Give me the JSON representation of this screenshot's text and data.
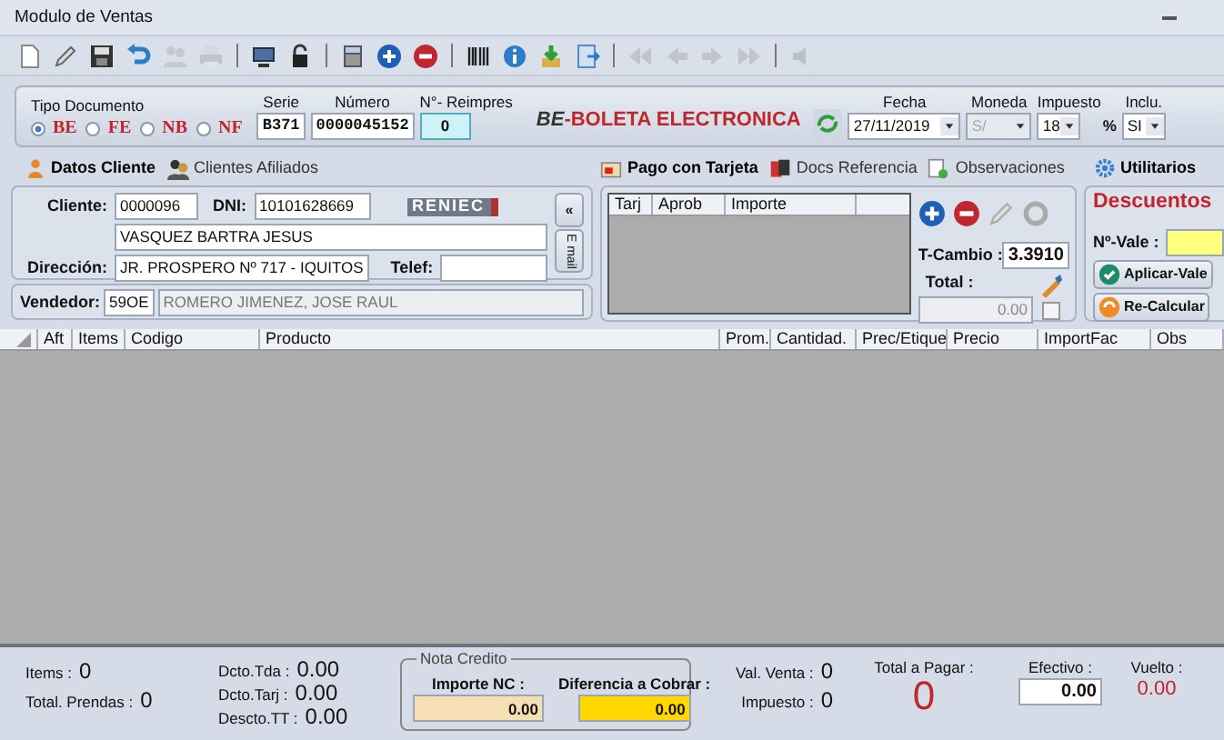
{
  "window": {
    "title": "Modulo de Ventas"
  },
  "toolbar": [
    [
      {
        "kind": "document",
        "disabled": false
      },
      {
        "kind": "pencil",
        "disabled": false
      },
      {
        "kind": "save",
        "disabled": false
      },
      {
        "kind": "undo",
        "disabled": false
      },
      {
        "kind": "people",
        "disabled": true
      },
      {
        "kind": "print",
        "disabled": true
      }
    ],
    [
      {
        "kind": "monitor",
        "disabled": false
      },
      {
        "kind": "lock",
        "disabled": false
      }
    ],
    [
      {
        "kind": "calculator",
        "disabled": false
      },
      {
        "kind": "plus",
        "disabled": false
      },
      {
        "kind": "minus",
        "disabled": false
      }
    ],
    [
      {
        "kind": "barcode",
        "disabled": false
      },
      {
        "kind": "info",
        "disabled": false
      },
      {
        "kind": "download",
        "disabled": false
      },
      {
        "kind": "export",
        "disabled": false
      }
    ],
    [
      {
        "kind": "first",
        "disabled": true
      },
      {
        "kind": "prev",
        "disabled": true
      },
      {
        "kind": "next",
        "disabled": true
      },
      {
        "kind": "last",
        "disabled": true
      }
    ],
    [
      {
        "kind": "speaker",
        "disabled": true
      }
    ]
  ],
  "doc_type": {
    "label": "Tipo Documento",
    "options": [
      {
        "label": "BE",
        "selected": true
      },
      {
        "label": "FE",
        "selected": false
      },
      {
        "label": "NB",
        "selected": false
      },
      {
        "label": "NF",
        "selected": false
      }
    ]
  },
  "serie": {
    "label": "Serie",
    "value": "B371"
  },
  "numero": {
    "label": "Número",
    "value": "0000045152"
  },
  "reimpres": {
    "label": "N°- Reimpres",
    "value": "0"
  },
  "doc_title": {
    "code": "BE",
    "name": "-BOLETA ELECTRONICA"
  },
  "fecha": {
    "label": "Fecha",
    "value": "27/11/2019"
  },
  "moneda": {
    "label": "Moneda",
    "value": "S/",
    "disabled": true
  },
  "impuesto": {
    "label": "Impuesto",
    "value": "18",
    "unit": "%"
  },
  "inclu": {
    "label": "Inclu.",
    "value": "SI"
  },
  "client_tabs": [
    {
      "label": "Datos Cliente",
      "selected": true
    },
    {
      "label": "Clientes Afiliados",
      "selected": false
    }
  ],
  "client": {
    "cliente_label": "Cliente:",
    "cliente": "0000096",
    "dni_label": "DNI:",
    "dni": "10101628669",
    "reniec": "RENIEC",
    "name": "VASQUEZ BARTRA JESUS",
    "direccion_label": "Dirección:",
    "direccion": "JR. PROSPERO Nº 717 - IQUITOS",
    "telef_label": "Telef:",
    "collapse": "«",
    "email": "E mail"
  },
  "vendedor": {
    "label": "Vendedor:",
    "code": "59OE",
    "name": "ROMERO JIMENEZ, JOSE RAUL"
  },
  "payment_tabs": [
    {
      "label": "Pago con Tarjeta",
      "selected": true
    },
    {
      "label": "Docs Referencia",
      "selected": false
    },
    {
      "label": "Observaciones",
      "selected": false
    }
  ],
  "card_table": {
    "columns": [
      "Tarj",
      "Aprob",
      "Importe"
    ]
  },
  "t_cambio": {
    "label": "T-Cambio :",
    "value": "3.3910"
  },
  "total": {
    "label": "Total :",
    "value": "0.00",
    "disabled": true,
    "checked": false
  },
  "utilitarios": {
    "tab": "Utilitarios",
    "title": "Descuentos",
    "vale_label": "Nº-Vale :",
    "buttons": [
      "Aplicar-Vale",
      "Re-Calcular"
    ]
  },
  "grid": {
    "columns": [
      "Aft",
      "Items",
      "Codigo",
      "Producto",
      "Prom.",
      "Cantidad.",
      "Prec/Etique",
      "Precio",
      "ImportFac",
      "Obs"
    ]
  },
  "footer": {
    "items": {
      "label": "Items :",
      "value": "0"
    },
    "prendas": {
      "label": "Total. Prendas :",
      "value": "0"
    },
    "dcto_tda": {
      "label": "Dcto.Tda :",
      "value": "0.00"
    },
    "dcto_tarj": {
      "label": "Dcto.Tarj :",
      "value": "0.00"
    },
    "descto_tt": {
      "label": "Descto.TT :",
      "value": "0.00"
    },
    "nota_credito": {
      "title": "Nota Credito",
      "importe_label": "Importe NC :",
      "importe": "0.00",
      "diferencia_label": "Diferencia a Cobrar :",
      "diferencia": "0.00"
    },
    "val_venta": {
      "label": "Val. Venta :",
      "value": "0"
    },
    "impuesto": {
      "label": "Impuesto :",
      "value": "0"
    },
    "total_pagar": {
      "label": "Total a Pagar :",
      "value": "0"
    },
    "efectivo": {
      "label": "Efectivo :",
      "value": "0.00"
    },
    "vuelto": {
      "label": "Vuelto :",
      "value": "0.00"
    }
  }
}
